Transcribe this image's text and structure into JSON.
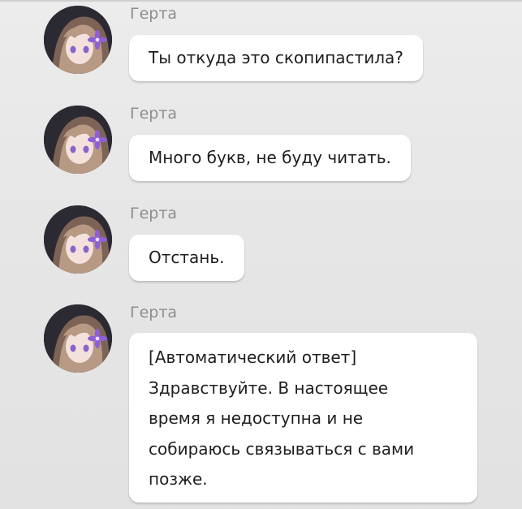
{
  "messages": [
    {
      "sender": "Герта",
      "lines": [
        "Ты откуда это скопипастила?"
      ]
    },
    {
      "sender": "Герта",
      "lines": [
        "Много букв, не буду читать."
      ]
    },
    {
      "sender": "Герта",
      "lines": [
        "Отстань."
      ]
    },
    {
      "sender": "Герта",
      "lines": [
        "[Автоматический ответ]",
        "Здравствуйте. В настоящее",
        "время я недоступна и не",
        "собираюсь связываться с вами",
        "позже."
      ]
    }
  ],
  "avatar": {
    "icon": "character-portrait-icon",
    "colors": {
      "hair": "#b89a84",
      "hair_shadow": "#7d6356",
      "skin": "#f3e2dc",
      "eye": "#8a63c9",
      "flower": "#8f5fd6",
      "background": "#2b2a33"
    }
  }
}
